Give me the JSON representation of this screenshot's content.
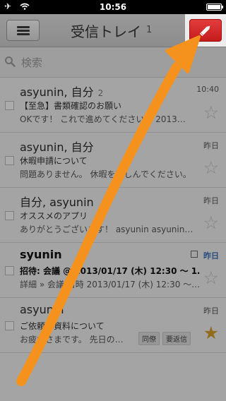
{
  "status_bar": {
    "time": "10:56"
  },
  "header": {
    "title": "受信トレイ",
    "count": "1"
  },
  "search": {
    "placeholder": "検索"
  },
  "emails": [
    {
      "sender": "asyunin, 自分",
      "thread_count": "2",
      "subject": "【至急】書類確認のお願い",
      "snippet": "OKです！ これで進めてください。 2013…",
      "date": "10:40",
      "starred": false,
      "unread": false
    },
    {
      "sender": "asyunin, 自分",
      "thread_count": "",
      "subject": "休暇申請について",
      "snippet": "問題ありません。 休暇を楽しんでください。",
      "date": "昨日",
      "starred": false,
      "unread": false
    },
    {
      "sender": "自分, asyunin",
      "thread_count": "",
      "subject": "オススメのアプリ",
      "snippet": "ありがとうございます！ asyunin asyunin…",
      "date": "昨日",
      "starred": false,
      "unread": false
    },
    {
      "sender": "syunin",
      "thread_count": "",
      "subject": "招待: 会議 @ 2013/01/17 (木) 12:30 〜 1…",
      "snippet": "詳細 » 会議 日時 2013/01/17 (木) 12:30 〜…",
      "date": "昨日",
      "starred": false,
      "unread": true
    },
    {
      "sender": "asyunin",
      "thread_count": "",
      "subject": "ご依頼の資料について",
      "snippet": "お疲れさまです。 先日の…",
      "date": "昨日",
      "starred": true,
      "unread": false,
      "labels": [
        "同僚",
        "要返信"
      ]
    }
  ],
  "colors": {
    "compose_accent": "#d22a2a",
    "annotation_arrow": "#f5921e",
    "starred": "#d39a2a",
    "calendar_date": "#3a6fb0"
  },
  "icons": {
    "menu": "hamburger-icon",
    "compose": "pencil-icon",
    "search": "magnifier-icon",
    "star": "star-icon",
    "calendar": "calendar-icon"
  }
}
